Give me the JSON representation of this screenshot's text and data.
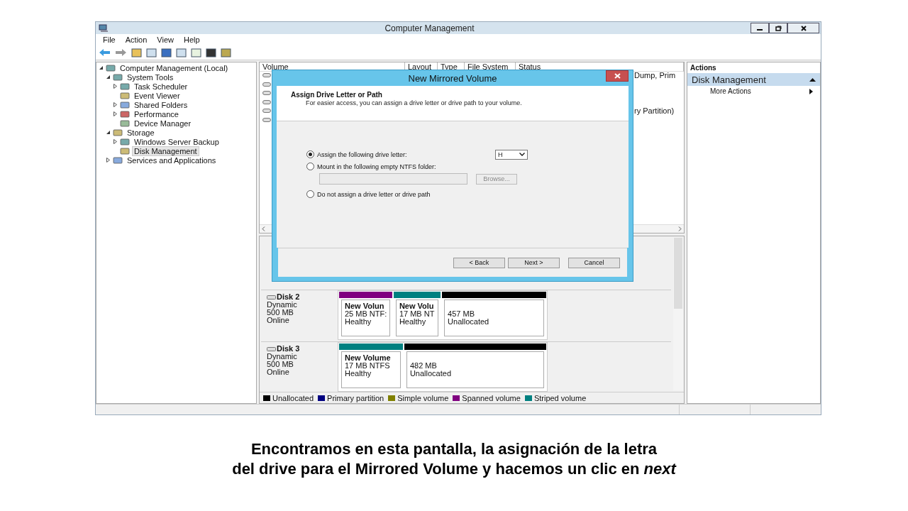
{
  "window": {
    "title": "Computer Management"
  },
  "menu": [
    "File",
    "Action",
    "View",
    "Help"
  ],
  "tree": [
    {
      "label": "Computer Management (Local)",
      "expanded": true,
      "selected": false,
      "children": [
        {
          "label": "System Tools",
          "expanded": true,
          "selected": false,
          "children": [
            {
              "label": "Task Scheduler",
              "expanded": false,
              "selected": false
            },
            {
              "label": "Event Viewer",
              "selected": false
            },
            {
              "label": "Shared Folders",
              "expanded": false,
              "selected": false
            },
            {
              "label": "Performance",
              "expanded": false,
              "selected": false
            },
            {
              "label": "Device Manager",
              "selected": false
            }
          ]
        },
        {
          "label": "Storage",
          "expanded": true,
          "selected": false,
          "children": [
            {
              "label": "Windows Server Backup",
              "expanded": false,
              "selected": false
            },
            {
              "label": "Disk Management",
              "selected": true
            }
          ]
        },
        {
          "label": "Services and Applications",
          "expanded": false,
          "selected": false
        }
      ]
    }
  ],
  "volume_table": {
    "columns": [
      "Volume",
      "Layout",
      "Type",
      "File System",
      "Status"
    ],
    "rows": [
      {
        "status": "Dump, Prim"
      },
      {},
      {},
      {},
      {
        "status": "ry Partition)"
      },
      {}
    ]
  },
  "disks": [
    {
      "name": "Disk 2",
      "type": "Dynamic",
      "size": "500 MB",
      "state": "Online",
      "partitions": [
        {
          "name": "New Volun",
          "detail": "25 MB NTF:",
          "status": "Healthy",
          "color": "#800080"
        },
        {
          "name": "New Volu",
          "detail": "17 MB NT",
          "status": "Healthy",
          "color": "#008080"
        },
        {
          "detail": "457 MB",
          "status": "Unallocated",
          "color": "#000000"
        }
      ]
    },
    {
      "name": "Disk 3",
      "type": "Dynamic",
      "size": "500 MB",
      "state": "Online",
      "partitions": [
        {
          "name": "New Volume",
          "detail": "17 MB NTFS",
          "status": "Healthy",
          "color": "#008080"
        },
        {
          "detail": "482 MB",
          "status": "Unallocated",
          "color": "#000000"
        }
      ]
    }
  ],
  "legend": [
    {
      "label": "Unallocated",
      "color": "#000000"
    },
    {
      "label": "Primary partition",
      "color": "#000080"
    },
    {
      "label": "Simple volume",
      "color": "#808000"
    },
    {
      "label": "Spanned volume",
      "color": "#800080"
    },
    {
      "label": "Striped volume",
      "color": "#008080"
    }
  ],
  "actions": {
    "title": "Actions",
    "section": "Disk Management",
    "items": [
      "More Actions"
    ]
  },
  "dialog": {
    "title": "New Mirrored Volume",
    "heading": "Assign Drive Letter or Path",
    "subtitle": "For easier access, you can assign a drive letter or drive path to your volume.",
    "options": [
      {
        "label": "Assign the following drive letter:",
        "selected": true
      },
      {
        "label": "Mount in the following empty NTFS folder:",
        "selected": false
      },
      {
        "label": "Do not assign a drive letter or drive path",
        "selected": false
      }
    ],
    "drive_letter": "H",
    "browse": {
      "label": "Browse...",
      "disabled": true
    },
    "buttons": [
      "< Back",
      "Next >",
      "Cancel"
    ]
  },
  "caption_lines": [
    "Encontramos en esta pantalla, la asignación de la letra",
    "del drive para el Mirrored Volume y hacemos un clic en *next*"
  ]
}
